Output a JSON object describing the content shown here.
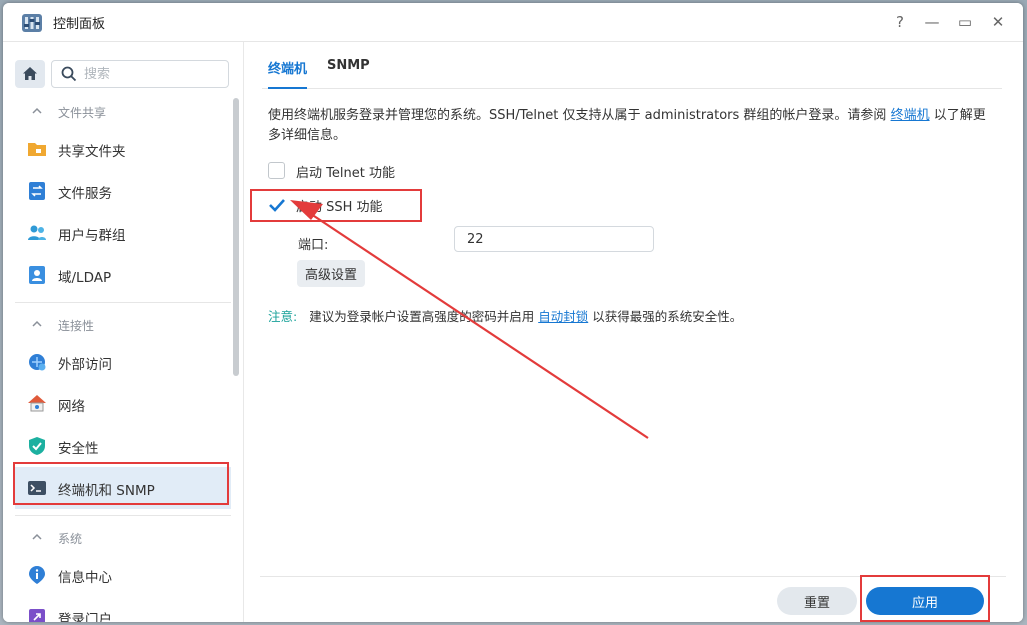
{
  "window": {
    "title": "控制面板"
  },
  "controls": {
    "help": "?",
    "minimize": "—",
    "maximize": "▭",
    "close": "✕"
  },
  "search": {
    "placeholder": "搜索"
  },
  "sidebar": {
    "sections": [
      {
        "title": "文件共享",
        "items": [
          "共享文件夹",
          "文件服务",
          "用户与群组",
          "域/LDAP"
        ]
      },
      {
        "title": "连接性",
        "items": [
          "外部访问",
          "网络",
          "安全性",
          "终端机和 SNMP"
        ]
      },
      {
        "title": "系统",
        "items": [
          "信息中心",
          "登录门户"
        ]
      }
    ],
    "active_item": "终端机和 SNMP"
  },
  "tabs": [
    {
      "label": "终端机"
    },
    {
      "label": "SNMP"
    }
  ],
  "main": {
    "description_pre": "使用终端机服务登录并管理您的系统。SSH/Telnet 仅支持从属于 administrators 群组的帐户登录。请参阅 ",
    "description_link": "终端机",
    "description_post": " 以了解更多详细信息。",
    "telnet_label": "启动 Telnet 功能",
    "telnet_checked": false,
    "ssh_label": "启动 SSH 功能",
    "ssh_checked": true,
    "port_label": "端口:",
    "port_value": "22",
    "advanced_label": "高级设置",
    "note_label": "注意:",
    "note_pre": "建议为登录帐户设置高强度的密码并启用 ",
    "note_link": "自动封锁",
    "note_post": " 以获得最强的系统安全性。"
  },
  "footer": {
    "reset_label": "重置",
    "apply_label": "应用"
  },
  "colors": {
    "accent": "#1677d2",
    "annotation": "#e33b3b",
    "note": "#1aa29a"
  }
}
